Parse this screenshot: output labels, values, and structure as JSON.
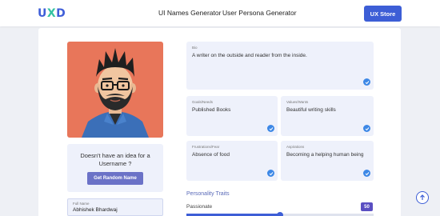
{
  "header": {
    "logo": {
      "part1": "U",
      "part2": "X",
      "part3": "D"
    },
    "nav": [
      "UI Names Generator",
      "User Persona Generator"
    ],
    "cta_label": "UX Store"
  },
  "profile": {
    "idea_text": "Doesn't have an idea for a Username ?",
    "random_button": "Get Random Name",
    "fullname_label": "Full Name",
    "fullname_value": "Abhishek Bhardwaj"
  },
  "fields": {
    "bio": {
      "label": "Bio",
      "value": "A writer on the outside and reader from the inside."
    },
    "goals": {
      "label": "Goals/Needs",
      "value": "Published Books"
    },
    "values": {
      "label": "Values/Wants",
      "value": "Beautiful writing skills"
    },
    "frustrations": {
      "label": "Frustrations/Fear",
      "value": "Absence of food"
    },
    "aspirations": {
      "label": "Aspirations",
      "value": "Becoming a helping human being"
    }
  },
  "traits": {
    "title": "Personality Traits",
    "items": [
      {
        "name": "Passionate",
        "value": "50",
        "level": 50
      }
    ]
  },
  "colors": {
    "accent": "#3d5ed6",
    "avatar_bg": "#e8765a",
    "check": "#3d88e6",
    "logo_teal": "#35c3a2"
  }
}
